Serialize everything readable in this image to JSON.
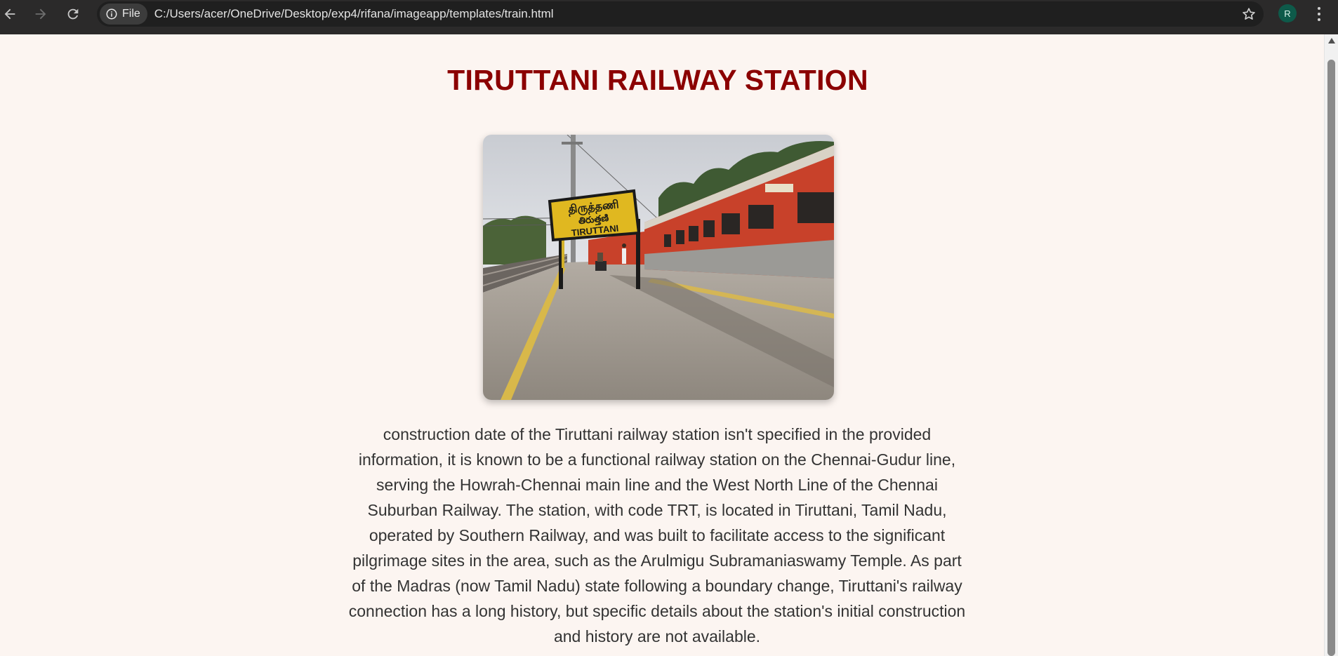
{
  "browser": {
    "site_chip_label": "File",
    "url": "C:/Users/acer/OneDrive/Desktop/exp4/rifana/imageapp/templates/train.html",
    "profile_initial": "R",
    "icons": [
      "back-icon",
      "forward-icon",
      "reload-icon",
      "info-icon",
      "star-icon",
      "more-menu-icon"
    ]
  },
  "page": {
    "title": "TIRUTTANI RAILWAY STATION",
    "image": {
      "sign_text_line1": "திருத்தணி",
      "sign_text_line2": "తిరుత్తణి",
      "sign_text_line3": "TIRUTTANI"
    },
    "description": "construction date of the Tiruttani railway station isn't specified in the provided information, it is known to be a functional railway station on the Chennai-Gudur line, serving the Howrah-Chennai main line and the West North Line of the Chennai Suburban Railway. The station, with code TRT, is located in Tiruttani, Tamil Nadu, operated by Southern Railway, and was built to facilitate access to the significant pilgrimage sites in the area, such as the Arulmigu Subramaniaswamy Temple. As part of the Madras (now Tamil Nadu) state following a boundary change, Tiruttani's railway connection has a long history, but specific details about the station's initial construction and history are not available."
  },
  "colors": {
    "title": "#8b0000",
    "background": "#fcf5f1",
    "chrome": "#2b2a2a"
  }
}
